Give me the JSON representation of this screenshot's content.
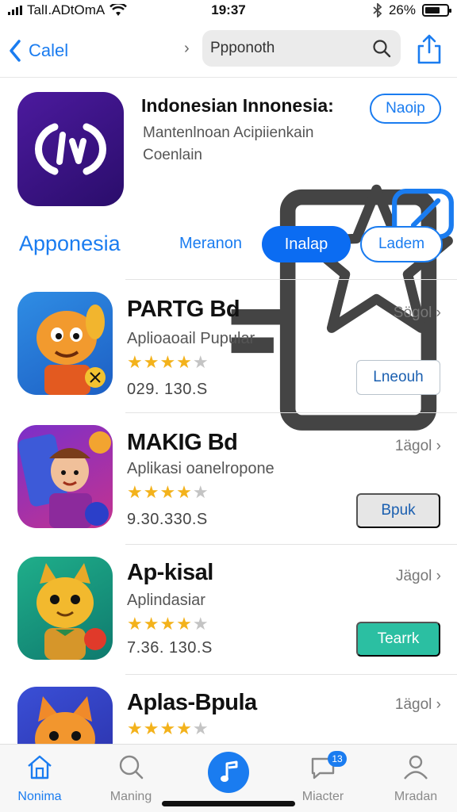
{
  "status_bar": {
    "carrier": "TalI.ADtOmA",
    "time": "19:37",
    "battery": "26%"
  },
  "nav": {
    "back_label": "Calel",
    "search_value": "Ppponoth"
  },
  "hero": {
    "title": "Indonesian Innonesia:",
    "subtitle": "Mantenlnoan Acipiienkain Coenlain",
    "action_label": "Naoip"
  },
  "section": {
    "title": "Apponesia",
    "segments": [
      "Meranon",
      "Inalap",
      "Ladem"
    ]
  },
  "apps": [
    {
      "title": "PARTG Bd",
      "subtitle": "Aplioaoail Pupular",
      "rating": 4.5,
      "downloads": "029. 130.S",
      "meta": "Sögol",
      "button": "Lneouh",
      "button_style": "outline"
    },
    {
      "title": "MAKIG Bd",
      "subtitle": "Aplikasi oanelropone",
      "rating": 4.5,
      "downloads": "9.30.330.S",
      "meta": "1ägol",
      "button": "Bpuk",
      "button_style": "grey"
    },
    {
      "title": "Ap-kisal",
      "subtitle": "Aplindasiar",
      "rating": 4.5,
      "downloads": "7.36. 130.S",
      "meta": "Jägol",
      "button": "Tearrk",
      "button_style": "teal"
    },
    {
      "title": "Aplas-Bpula",
      "subtitle": "",
      "rating": 4.5,
      "downloads": "",
      "meta": "1ägol",
      "button": "",
      "button_style": "none"
    }
  ],
  "tab_bar": {
    "items": [
      "Nonima",
      "Maning",
      "",
      "Miacter",
      "Mradan"
    ],
    "badge": "13",
    "active_index": 0
  },
  "colors": {
    "accent": "#1a7cf0",
    "star": "#f3b21b",
    "teal": "#2bbfa2"
  }
}
